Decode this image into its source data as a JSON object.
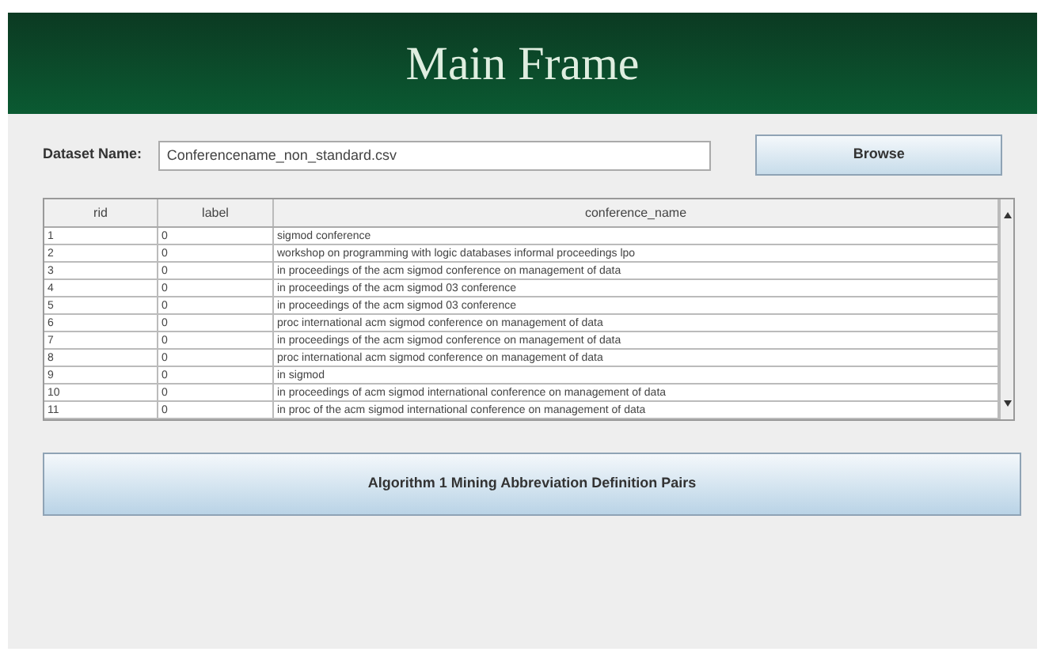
{
  "window": {
    "title": "Main Frame"
  },
  "dataset": {
    "label": "Dataset Name:",
    "value": "Conferencename_non_standard.csv"
  },
  "browse_button": "Browse",
  "table": {
    "columns": [
      "rid",
      "label",
      "conference_name"
    ],
    "rows": [
      [
        "1",
        "0",
        "sigmod conference"
      ],
      [
        "2",
        "0",
        "workshop on programming with logic databases informal proceedings lpo"
      ],
      [
        "3",
        "0",
        "in proceedings of the acm sigmod conference on management of data"
      ],
      [
        "4",
        "0",
        "in proceedings of the acm sigmod 03 conference"
      ],
      [
        "5",
        "0",
        "in proceedings of the acm sigmod 03 conference"
      ],
      [
        "6",
        "0",
        "proc international acm sigmod conference on management of data"
      ],
      [
        "7",
        "0",
        "in proceedings of the acm sigmod conference on management of data"
      ],
      [
        "8",
        "0",
        "proc international acm sigmod conference on management of data"
      ],
      [
        "9",
        "0",
        "in sigmod"
      ],
      [
        "10",
        "0",
        "in proceedings of acm sigmod international conference on management of data"
      ],
      [
        "11",
        "0",
        "in proc of the acm sigmod international conference on management of data"
      ]
    ]
  },
  "action_button": "Algorithm 1 Mining Abbreviation Definition Pairs"
}
